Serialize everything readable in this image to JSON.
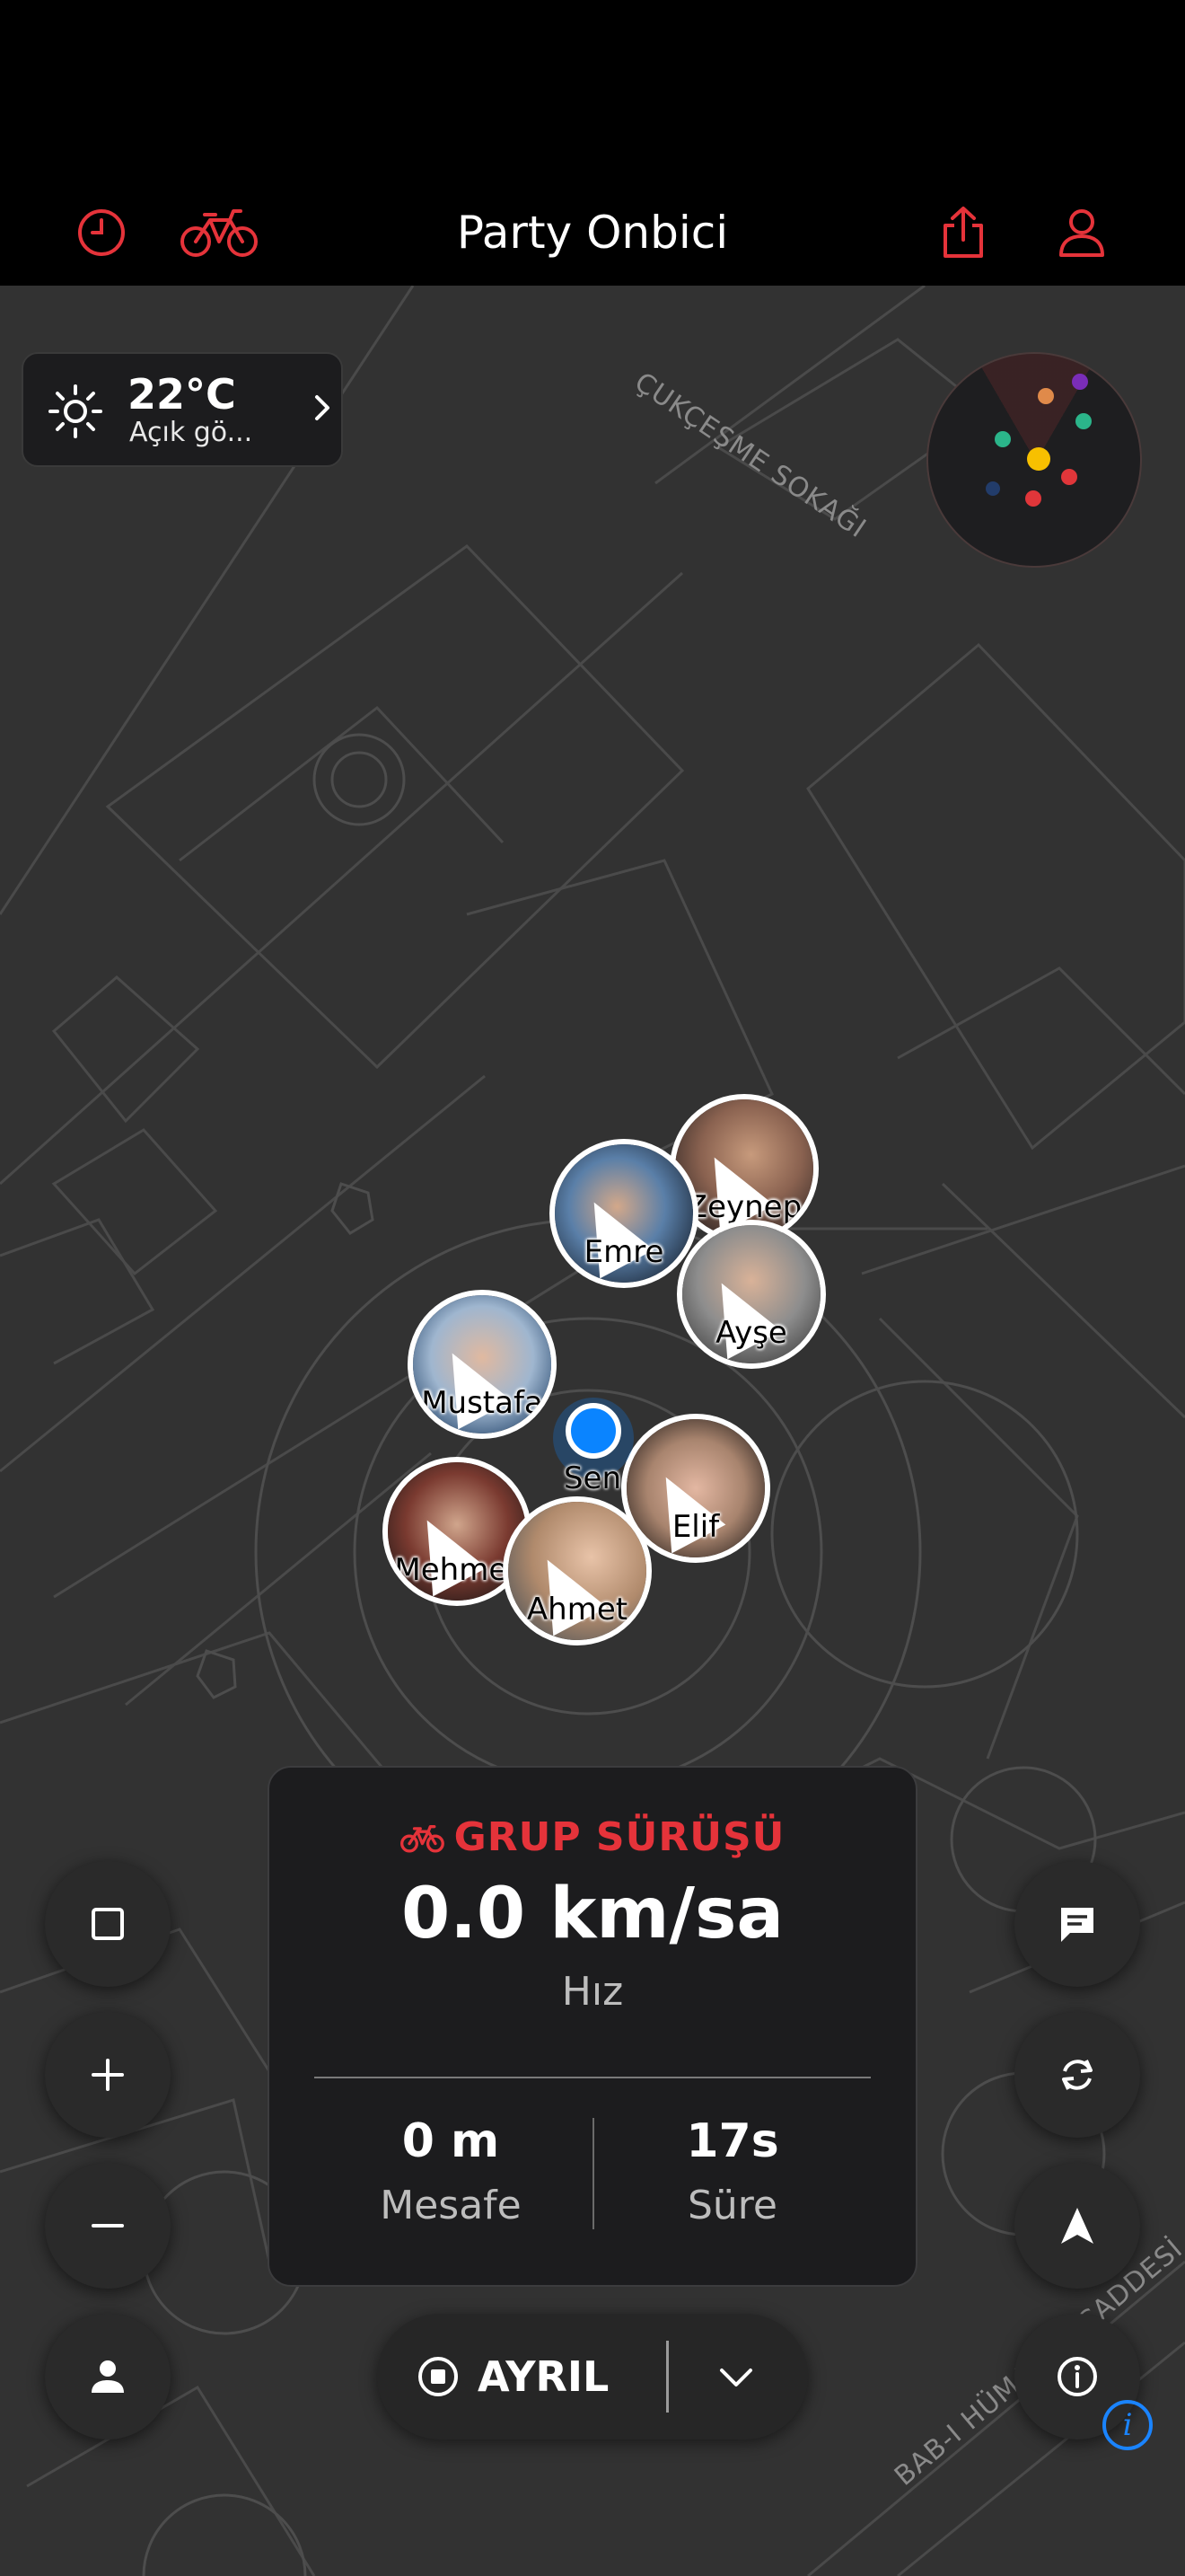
{
  "header": {
    "title": "Party Onbici",
    "left_icons": [
      "history-icon",
      "bike-icon"
    ],
    "right_icons": [
      "share-icon",
      "profile-icon"
    ]
  },
  "weather": {
    "temperature": "22°C",
    "condition": "Açık gö..."
  },
  "map": {
    "streets": [
      "ÇUKÇEŞME SOKAĞI",
      "BAB-I HÜMAYUN CADDESİ"
    ]
  },
  "radar": {
    "dot_colors": [
      "#e08a4a",
      "#7a2db8",
      "#2bb58a",
      "#2bb58a",
      "#e0363a",
      "#f7c000",
      "#e0363a",
      "#e0363a",
      "#223c6a"
    ]
  },
  "riders": [
    {
      "name": "Zeynep"
    },
    {
      "name": "Emre"
    },
    {
      "name": "Ayşe"
    },
    {
      "name": "Mustafa"
    },
    {
      "name": "Elif"
    },
    {
      "name": "Mehmet"
    },
    {
      "name": "Ahmet"
    }
  ],
  "me": {
    "label": "Sen"
  },
  "panel": {
    "mode": "GRUP SÜRÜŞÜ",
    "speed": "0.0 km/sa",
    "speed_label": "Hız",
    "distance": "0 m",
    "distance_label": "Mesafe",
    "duration": "17s",
    "duration_label": "Süre"
  },
  "controls": {
    "leave_label": "AYRIL",
    "left": [
      "square-icon",
      "zoom-in-icon",
      "zoom-out-icon",
      "person-icon"
    ],
    "right": [
      "chat-icon",
      "refresh-icon",
      "navigate-icon",
      "info-icon"
    ]
  },
  "colors": {
    "accent": "#e5333a",
    "location_blue": "#0a84ff",
    "background": "#000000",
    "map": "#323232"
  }
}
